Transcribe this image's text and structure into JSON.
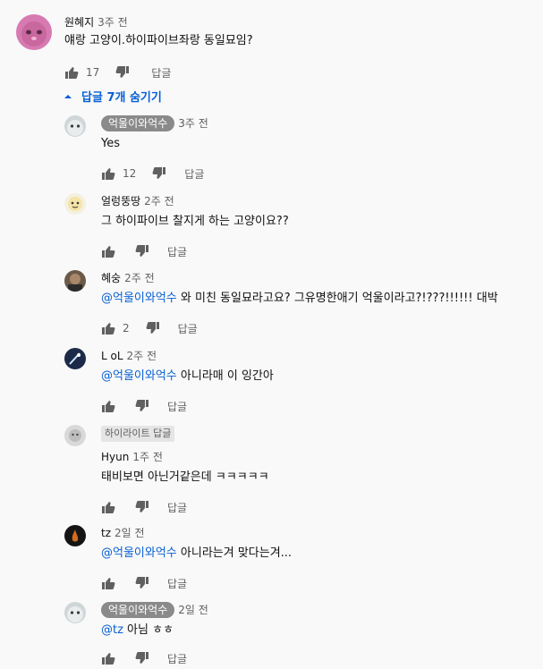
{
  "top": {
    "author": "원혜지",
    "time": "3주 전",
    "text": "얘랑 고양이.하이파이브좌랑 동일묘임?",
    "likes": "17",
    "reply_label": "답글"
  },
  "toggle_label": "답글 7개 숨기기",
  "replies": [
    {
      "author": "억울이와억수",
      "time": "3주 전",
      "text": "Yes",
      "likes": "12",
      "reply_label": "답글"
    },
    {
      "author": "얼렁뚱땅",
      "time": "2주 전",
      "text": "그 하이파이브 찰지게 하는 고양이요??",
      "reply_label": "답글"
    },
    {
      "author": "혜숭",
      "time": "2주 전",
      "mention": "@억울이와억수",
      "text": " 와 미친 동일묘라고요? 그유명한애기 억울이라고?!???!!!!!! 대박",
      "likes": "2",
      "reply_label": "답글"
    },
    {
      "author": "L oL",
      "time": "2주 전",
      "mention": "@억울이와억수",
      "text": " 아니라매 이 잉간아",
      "reply_label": "답글"
    },
    {
      "highlight": "하이라이트 답글",
      "author": "Hyun",
      "time": "1주 전",
      "text": "태비보면 아닌거같은데 ㅋㅋㅋㅋㅋ",
      "reply_label": "답글"
    },
    {
      "author": "tz",
      "time": "2일 전",
      "mention": "@억울이와억수",
      "text": " 아니라는겨 맞다는겨...",
      "reply_label": "답글"
    },
    {
      "author": "억울이와억수",
      "time": "2일 전",
      "mention": "@tz",
      "text": " 아님 ㅎㅎ",
      "reply_label": "답글"
    }
  ],
  "colors": {
    "link": "#065fd4",
    "muted": "#606060",
    "chip": "#8a8a8a"
  }
}
